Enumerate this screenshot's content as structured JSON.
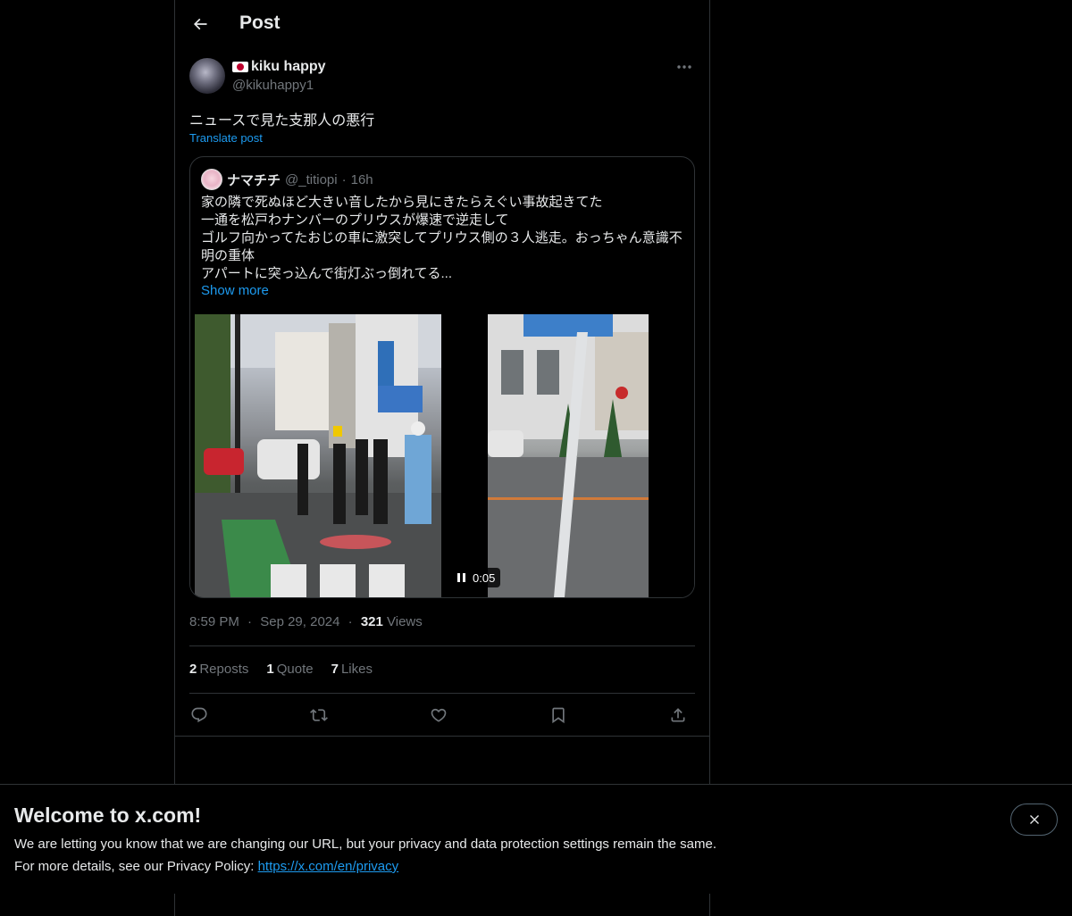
{
  "header": {
    "title": "Post"
  },
  "author": {
    "display_name": "kiku happy",
    "handle": "@kikuhappy1"
  },
  "post": {
    "text": "ニュースで見た支那人の悪行",
    "translate_label": "Translate post"
  },
  "quote": {
    "name": "ナマチチ",
    "handle": "@_titiopi",
    "separator": "·",
    "time": "16h",
    "lines": [
      "家の隣で死ぬほど大きい音したから見にきたらえぐい事故起きてた",
      "一通を松戸わナンバーのプリウスが爆速で逆走して",
      "ゴルフ向かってたおじの車に激突してプリウス側の３人逃走。おっちゃん意識不",
      "明の重体",
      "アパートに突っ込んで街灯ぶっ倒れてる..."
    ],
    "show_more": "Show more",
    "video_time": "0:05"
  },
  "meta": {
    "time": "8:59 PM",
    "dot": "·",
    "date": "Sep 29, 2024",
    "views_count": "321",
    "views_label": "Views"
  },
  "stats": {
    "reposts_count": "2",
    "reposts_label": "Reposts",
    "quotes_count": "1",
    "quotes_label": "Quote",
    "likes_count": "7",
    "likes_label": "Likes"
  },
  "banner": {
    "title": "Welcome to x.com!",
    "line1": "We are letting you know that we are changing our URL, but your privacy and data protection settings remain the same.",
    "line2_prefix": "For more details, see our Privacy Policy: ",
    "link": "https://x.com/en/privacy"
  },
  "icons": [
    "back-arrow-icon",
    "more-icon",
    "reply-icon",
    "repost-icon",
    "like-icon",
    "bookmark-icon",
    "share-icon",
    "close-icon",
    "pause-icon",
    "flag-japan-icon"
  ]
}
